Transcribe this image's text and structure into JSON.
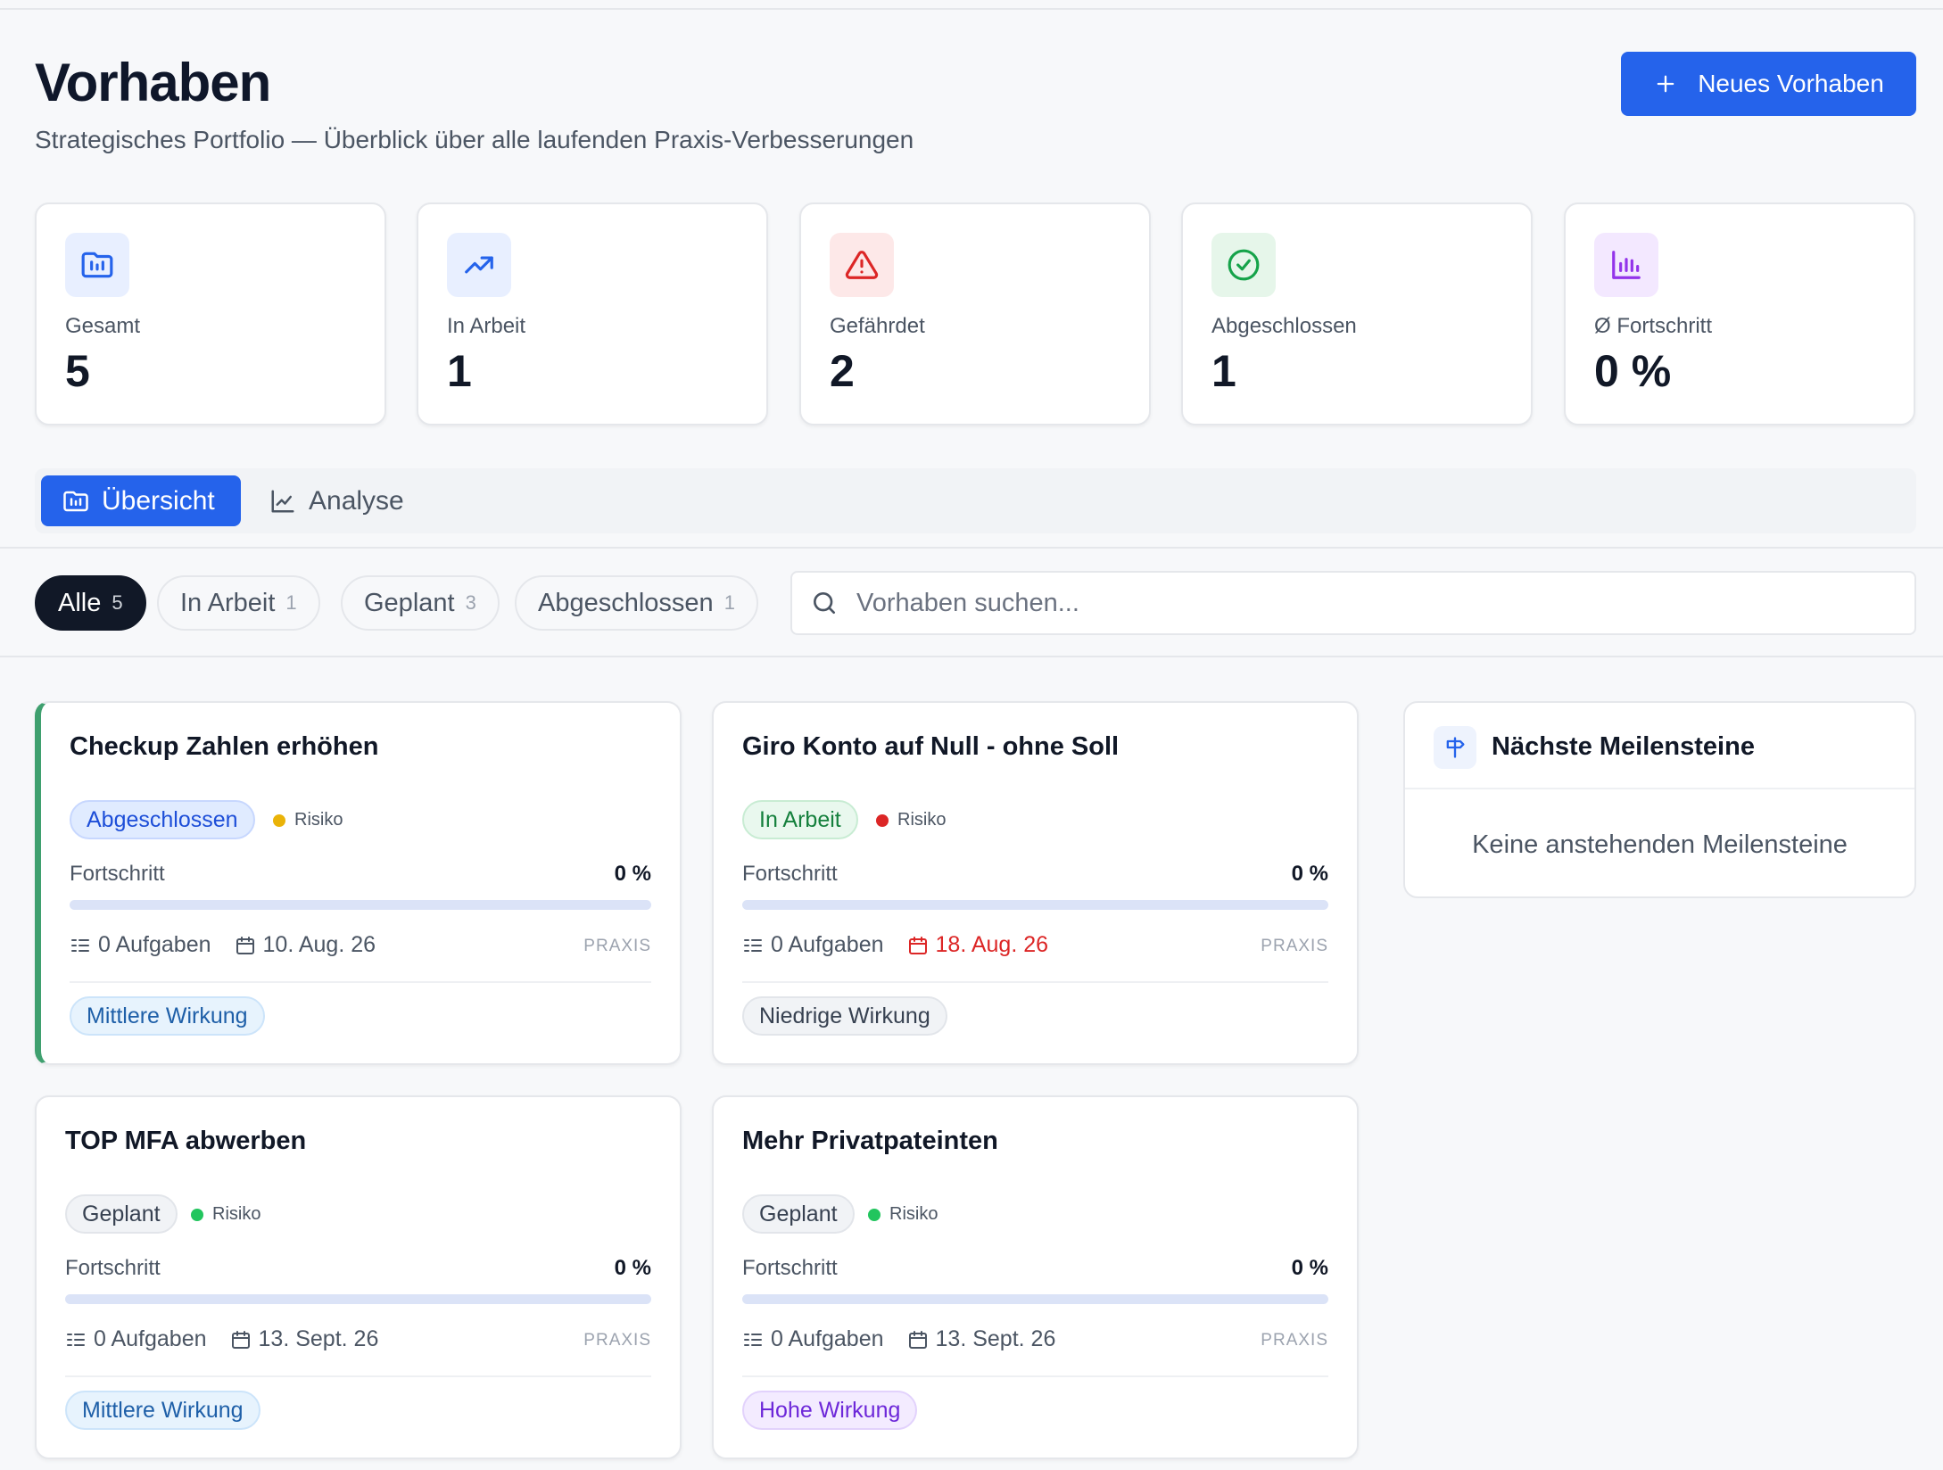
{
  "header": {
    "title": "Vorhaben",
    "subtitle": "Strategisches Portfolio — Überblick über alle laufenden Praxis-Verbesserungen",
    "new_button": "Neues Vorhaben"
  },
  "stats": [
    {
      "label": "Gesamt",
      "value": "5",
      "icon": "folder-chart-icon",
      "color": "#2563eb"
    },
    {
      "label": "In Arbeit",
      "value": "1",
      "icon": "trending-up-icon",
      "color": "#2563eb"
    },
    {
      "label": "Gefährdet",
      "value": "2",
      "icon": "alert-triangle-icon",
      "color": "#dc2626"
    },
    {
      "label": "Abgeschlossen",
      "value": "1",
      "icon": "check-circle-icon",
      "color": "#16a34a"
    },
    {
      "label": "Ø Fortschritt",
      "value": "0 %",
      "icon": "bar-chart-icon",
      "color": "#9333ea"
    }
  ],
  "tabs": [
    {
      "label": "Übersicht",
      "icon": "folder-chart-icon",
      "active": true
    },
    {
      "label": "Analyse",
      "icon": "line-chart-icon",
      "active": false
    }
  ],
  "filters": [
    {
      "label": "Alle",
      "count": "5",
      "active": true
    },
    {
      "label": "In Arbeit",
      "count": "1",
      "active": false
    },
    {
      "label": "Geplant",
      "count": "3",
      "active": false
    },
    {
      "label": "Abgeschlossen",
      "count": "1",
      "active": false
    }
  ],
  "search": {
    "placeholder": "Vorhaben suchen..."
  },
  "cards": [
    {
      "title": "Checkup Zahlen erhöhen",
      "status": "Abgeschlossen",
      "risk": "Risiko",
      "risk_color": "#eab308",
      "progress_label": "Fortschritt",
      "progress_value": "0 %",
      "progress": 0,
      "tasks": "0 Aufgaben",
      "date": "10. Aug. 26",
      "overdue": false,
      "scope": "PRAXIS",
      "impact": "Mittlere Wirkung"
    },
    {
      "title": "Giro Konto auf Null - ohne Soll",
      "status": "In Arbeit",
      "risk": "Risiko",
      "risk_color": "#dc2626",
      "progress_label": "Fortschritt",
      "progress_value": "0 %",
      "progress": 0,
      "tasks": "0 Aufgaben",
      "date": "18. Aug. 26",
      "overdue": true,
      "scope": "PRAXIS",
      "impact": "Niedrige Wirkung"
    },
    {
      "title": "TOP MFA abwerben",
      "status": "Geplant",
      "risk": "Risiko",
      "risk_color": "#22c55e",
      "progress_label": "Fortschritt",
      "progress_value": "0 %",
      "progress": 0,
      "tasks": "0 Aufgaben",
      "date": "13. Sept. 26",
      "overdue": false,
      "scope": "PRAXIS",
      "impact": "Mittlere Wirkung"
    },
    {
      "title": "Mehr Privatpateinten",
      "status": "Geplant",
      "risk": "Risiko",
      "risk_color": "#22c55e",
      "progress_label": "Fortschritt",
      "progress_value": "0 %",
      "progress": 0,
      "tasks": "0 Aufgaben",
      "date": "13. Sept. 26",
      "overdue": false,
      "scope": "PRAXIS",
      "impact": "Hohe Wirkung"
    }
  ],
  "milestones": {
    "title": "Nächste Meilensteine",
    "icon": "signpost-icon",
    "empty": "Keine anstehenden Meilensteine"
  }
}
